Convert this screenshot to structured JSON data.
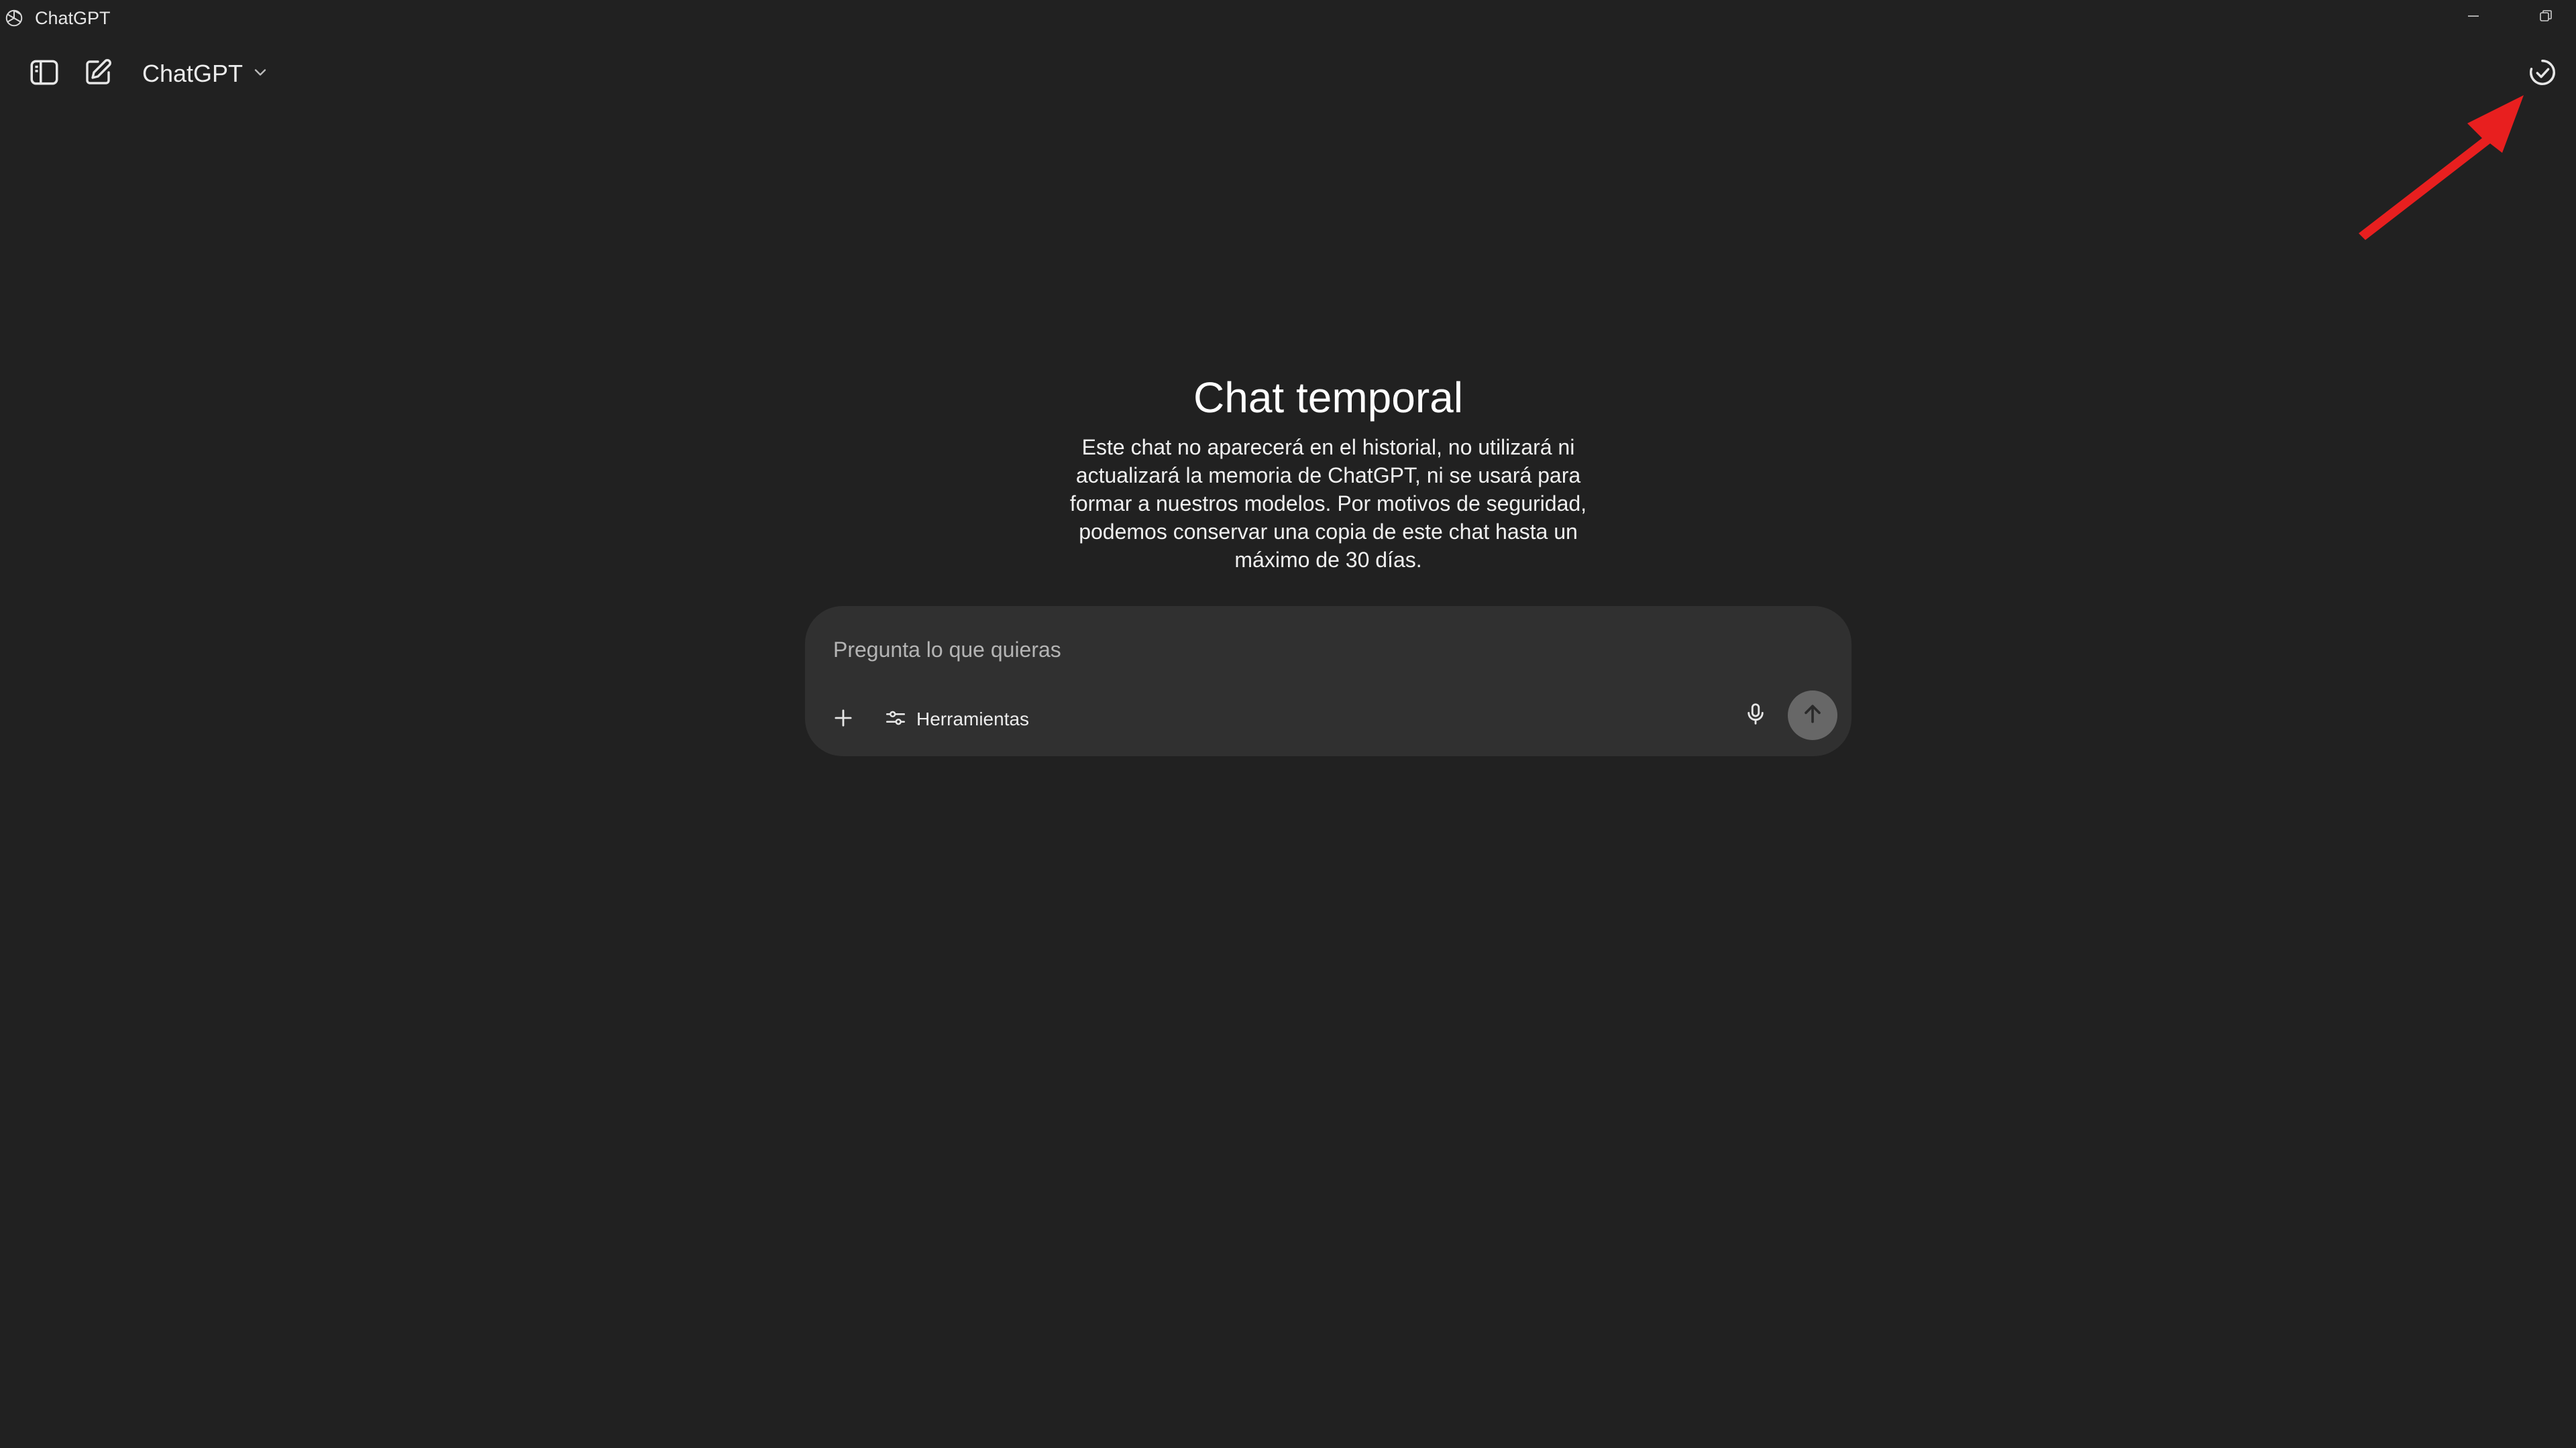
{
  "window": {
    "title": "ChatGPT",
    "logo_icon": "openai-logo-icon",
    "controls": [
      "minimize-icon",
      "restore-icon"
    ]
  },
  "toolbar": {
    "sidebar_icon": "sidebar-toggle-icon",
    "new_chat_icon": "new-chat-icon",
    "model_label": "ChatGPT",
    "model_chevron_icon": "chevron-down-icon",
    "temporary_chat_icon": "temporary-chat-icon"
  },
  "annotation": {
    "arrow_color": "#e81f1f",
    "points_to": "temporary-chat-button"
  },
  "hero": {
    "title": "Chat temporal",
    "description": "Este chat no aparecerá en el historial, no utilizará ni actualizará la memoria de ChatGPT, ni se usará para formar a nuestros modelos. Por motivos de seguridad, podemos conservar una copia de este chat hasta un máximo de 30 días."
  },
  "composer": {
    "placeholder": "Pregunta lo que quieras",
    "value": "",
    "add_icon": "plus-icon",
    "tools_icon": "sliders-icon",
    "tools_label": "Herramientas",
    "mic_icon": "microphone-icon",
    "send_icon": "arrow-up-icon"
  },
  "colors": {
    "background": "#212121",
    "composer": "#303030",
    "send_button": "#676767",
    "text": "#ececec",
    "placeholder": "#b4b4b4"
  }
}
